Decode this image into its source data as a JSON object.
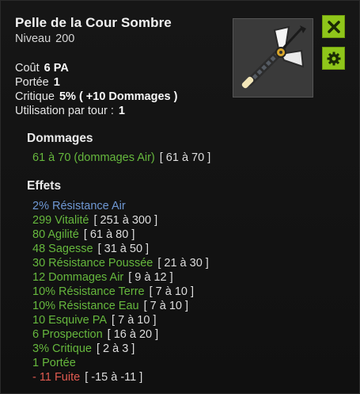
{
  "item": {
    "name": "Pelle de la Cour Sombre",
    "level_label": "Niveau",
    "level_value": "200",
    "icon": "shovel-axe-item-icon"
  },
  "stats": [
    {
      "label": "Coût",
      "value": "6 PA"
    },
    {
      "label": "Portée",
      "value": "1"
    },
    {
      "label": "Critique",
      "value": "5% ( +10 Dommages )"
    },
    {
      "label": "Utilisation par tour :",
      "value": "1"
    }
  ],
  "damage_section": {
    "title": "Dommages",
    "line": "61 à 70 (dommages Air)",
    "range": "[ 61 à 70 ]"
  },
  "effects_section": {
    "title": "Effets",
    "items": [
      {
        "text": "2% Résistance Air",
        "range": "",
        "color": "#6f98d4"
      },
      {
        "text": "299 Vitalité",
        "range": "[ 251 à 300 ]",
        "color": "#66b83d"
      },
      {
        "text": "80 Agilité",
        "range": "[ 61 à 80 ]",
        "color": "#66b83d"
      },
      {
        "text": "48 Sagesse",
        "range": "[ 31 à 50 ]",
        "color": "#66b83d"
      },
      {
        "text": "30 Résistance Poussée",
        "range": "[ 21 à 30 ]",
        "color": "#66b83d"
      },
      {
        "text": "12 Dommages Air",
        "range": "[ 9 à 12 ]",
        "color": "#66b83d"
      },
      {
        "text": "10% Résistance Terre",
        "range": "[ 7 à 10 ]",
        "color": "#66b83d"
      },
      {
        "text": "10% Résistance Eau",
        "range": "[ 7 à 10 ]",
        "color": "#66b83d"
      },
      {
        "text": "10 Esquive PA",
        "range": "[ 7 à 10 ]",
        "color": "#66b83d"
      },
      {
        "text": "6 Prospection",
        "range": "[ 16 à 20 ]",
        "color": "#66b83d"
      },
      {
        "text": "3% Critique",
        "range": "[ 2 à 3 ]",
        "color": "#66b83d"
      },
      {
        "text": "1 Portée",
        "range": "",
        "color": "#66b83d"
      },
      {
        "text": "- 11 Fuite",
        "range": "[ -15 à -11 ]",
        "color": "#e05a50"
      }
    ]
  },
  "buttons": {
    "close_icon": "close-icon",
    "settings_icon": "gear-icon",
    "accent": "#8fc61a"
  }
}
